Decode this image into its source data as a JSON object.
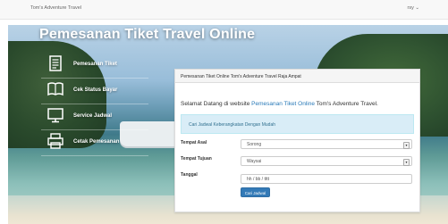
{
  "navbar": {
    "brand": "Tom's Adventure Travel",
    "user_menu": "rsy ⌄"
  },
  "hero": {
    "title": "Pemesanan Tiket Travel Online"
  },
  "side_menu": {
    "items": [
      {
        "label": "Pemesanan Tiket",
        "icon": "document-icon"
      },
      {
        "label": "Cek Status Bayar",
        "icon": "book-icon"
      },
      {
        "label": "Service Jadwal",
        "icon": "monitor-icon"
      },
      {
        "label": "Cetak Pemesanan",
        "icon": "printer-icon"
      }
    ]
  },
  "panel": {
    "heading": "Pemesanan Tiket Online Tom's Adventure Travel Raja Ampat",
    "welcome_prefix": "Selamat Datang di website ",
    "welcome_link": "Pemesanan Tiket Online",
    "welcome_suffix": " Tom's Adventure Travel.",
    "alert": "Cari Jadwal Keberangkatan Dengan Mudah",
    "fields": {
      "asal_label": "Tempat Asal",
      "asal_value": "Sorong",
      "tujuan_label": "Tempat Tujuan",
      "tujuan_value": "Waysai",
      "tanggal_label": "Tanggal",
      "tanggal_placeholder": "hh / bb / tttt"
    },
    "search_button": "Cari Jadwal"
  },
  "colors": {
    "accent": "#337ab7",
    "link": "#2a7ab8",
    "alert_bg": "#d9edf7"
  }
}
